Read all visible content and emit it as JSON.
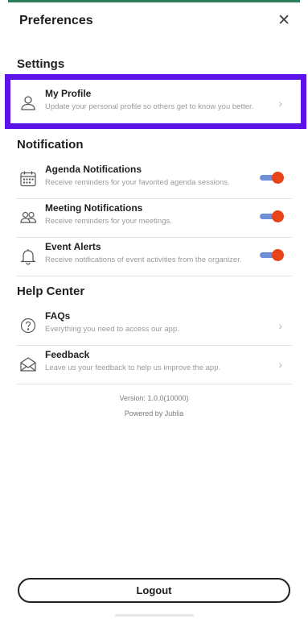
{
  "header": {
    "title": "Preferences",
    "close_symbol": "✕"
  },
  "settings": {
    "section_title": "Settings",
    "items": [
      {
        "label": "My Profile",
        "description": "Update your personal profile so others get to know you better.",
        "icon": "user-icon"
      }
    ]
  },
  "notification": {
    "section_title": "Notification",
    "items": [
      {
        "label": "Agenda Notifications",
        "description": "Receive reminders for your favorited agenda sessions.",
        "icon": "calendar-icon",
        "enabled": true
      },
      {
        "label": "Meeting Notifications",
        "description": "Receive reminders for your meetings.",
        "icon": "people-icon",
        "enabled": true
      },
      {
        "label": "Event Alerts",
        "description": "Receive notifications of event activities from the organizer.",
        "icon": "bell-icon",
        "enabled": true
      }
    ]
  },
  "help_center": {
    "section_title": "Help Center",
    "items": [
      {
        "label": "FAQs",
        "description": "Everything you need to access our app.",
        "icon": "question-icon"
      },
      {
        "label": "Feedback",
        "description": "Leave us your feedback to help us improve the app.",
        "icon": "envelope-icon"
      }
    ]
  },
  "footer": {
    "version": "Version: 1.0.0(10000)",
    "powered_by": "Powered by Jublia"
  },
  "logout_label": "Logout",
  "colors": {
    "highlight_border": "#5b13e8",
    "toggle_track": "#6d8fd8",
    "toggle_knob": "#e8441c",
    "top_line": "#2e7d5b"
  }
}
